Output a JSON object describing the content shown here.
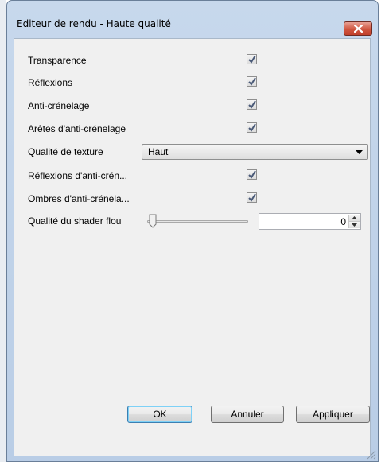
{
  "window": {
    "title": "Editeur de rendu - Haute qualité",
    "close_icon": "close-icon",
    "accent_close": "#c7432f"
  },
  "settings": {
    "transparence": {
      "label": "Transparence",
      "checked": true
    },
    "reflexions": {
      "label": "Réflexions",
      "checked": true
    },
    "anticrenelage": {
      "label": "Anti-crénelage",
      "checked": true
    },
    "aretes": {
      "label": "Arêtes d'anti-crénelage",
      "checked": true
    },
    "texture": {
      "label": "Qualité de texture",
      "value": "Haut"
    },
    "reflexions_ac": {
      "label": "Réflexions d'anti-crén...",
      "checked": true
    },
    "ombres_ac": {
      "label": "Ombres d'anti-crénela...",
      "checked": true
    },
    "shader": {
      "label": "Qualité du shader flou",
      "value": "0",
      "slider_level": 0
    }
  },
  "buttons": {
    "ok": "OK",
    "cancel": "Annuler",
    "apply": "Appliquer"
  }
}
